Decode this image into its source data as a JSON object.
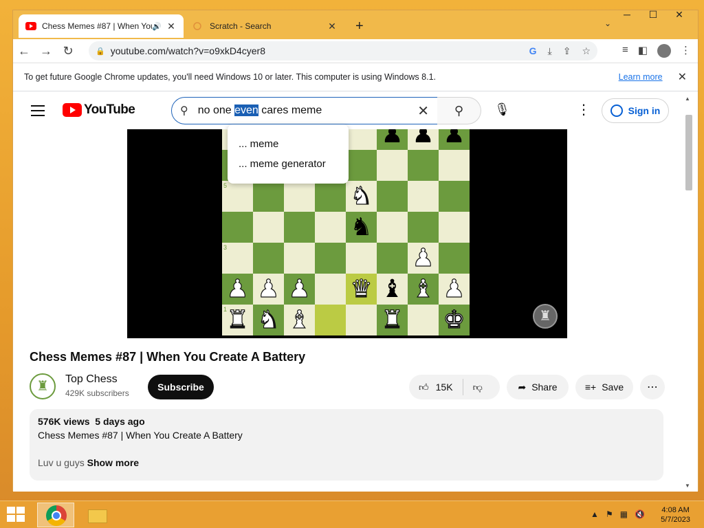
{
  "tabs": [
    {
      "title": "Chess Memes #87 | When You Create A Battery",
      "active": true,
      "audio": true
    },
    {
      "title": "Scratch - Search",
      "active": false
    }
  ],
  "address": {
    "url": "youtube.com/watch?v=o9xkD4cyer8"
  },
  "infobar": {
    "message": "To get future Google Chrome updates, you'll need Windows 10 or later. This computer is using Windows 8.1.",
    "link": "Learn more"
  },
  "youtube": {
    "logo_text": "YouTube",
    "search": {
      "before": "no one ",
      "highlight": "even",
      "after": " cares meme"
    },
    "suggestions": [
      "... meme",
      "... meme generator"
    ],
    "signin_label": "Sign in"
  },
  "board": {
    "ranks_visible": [
      "7",
      "6",
      "5",
      "4",
      "3",
      "2",
      "1"
    ],
    "files_visible": [
      "d",
      "e",
      "g",
      "h"
    ],
    "pieces": [
      {
        "square": "f7",
        "piece": "♟",
        "color": "b"
      },
      {
        "square": "g7",
        "piece": "♟",
        "color": "b"
      },
      {
        "square": "h7",
        "piece": "♟",
        "color": "b"
      },
      {
        "square": "e5",
        "piece": "♞",
        "color": "w"
      },
      {
        "square": "e4",
        "piece": "♞",
        "color": "b"
      },
      {
        "square": "g3",
        "piece": "♟",
        "color": "w"
      },
      {
        "square": "a2",
        "piece": "♟",
        "color": "w"
      },
      {
        "square": "b2",
        "piece": "♟",
        "color": "w"
      },
      {
        "square": "c2",
        "piece": "♟",
        "color": "w"
      },
      {
        "square": "e2",
        "piece": "♛",
        "color": "w"
      },
      {
        "square": "f2",
        "piece": "♝",
        "color": "b"
      },
      {
        "square": "g2",
        "piece": "♝",
        "color": "w"
      },
      {
        "square": "h2",
        "piece": "♟",
        "color": "w"
      },
      {
        "square": "a1",
        "piece": "♜",
        "color": "w"
      },
      {
        "square": "b1",
        "piece": "♞",
        "color": "w"
      },
      {
        "square": "c1",
        "piece": "♝",
        "color": "w"
      },
      {
        "square": "f1",
        "piece": "♜",
        "color": "w"
      },
      {
        "square": "h1",
        "piece": "♚",
        "color": "w"
      }
    ],
    "highlighted": [
      "d1",
      "e2"
    ]
  },
  "video": {
    "title": "Chess Memes #87 | When You Create A Battery",
    "channel": "Top Chess",
    "subscribers": "429K subscribers",
    "subscribe_label": "Subscribe",
    "likes": "15K",
    "share_label": "Share",
    "save_label": "Save",
    "views": "576K views",
    "age": "5 days ago",
    "description_line": "Chess Memes #87 | When You Create A Battery",
    "description_snippet": "Luv u guys",
    "show_more": "Show more"
  },
  "taskbar": {
    "time": "4:08 AM",
    "date": "5/7/2023"
  },
  "colors": {
    "board_dark": "#6c9b3e",
    "board_light": "#eeeed2",
    "yt_red": "#ff0000",
    "link_blue": "#065fd4"
  }
}
